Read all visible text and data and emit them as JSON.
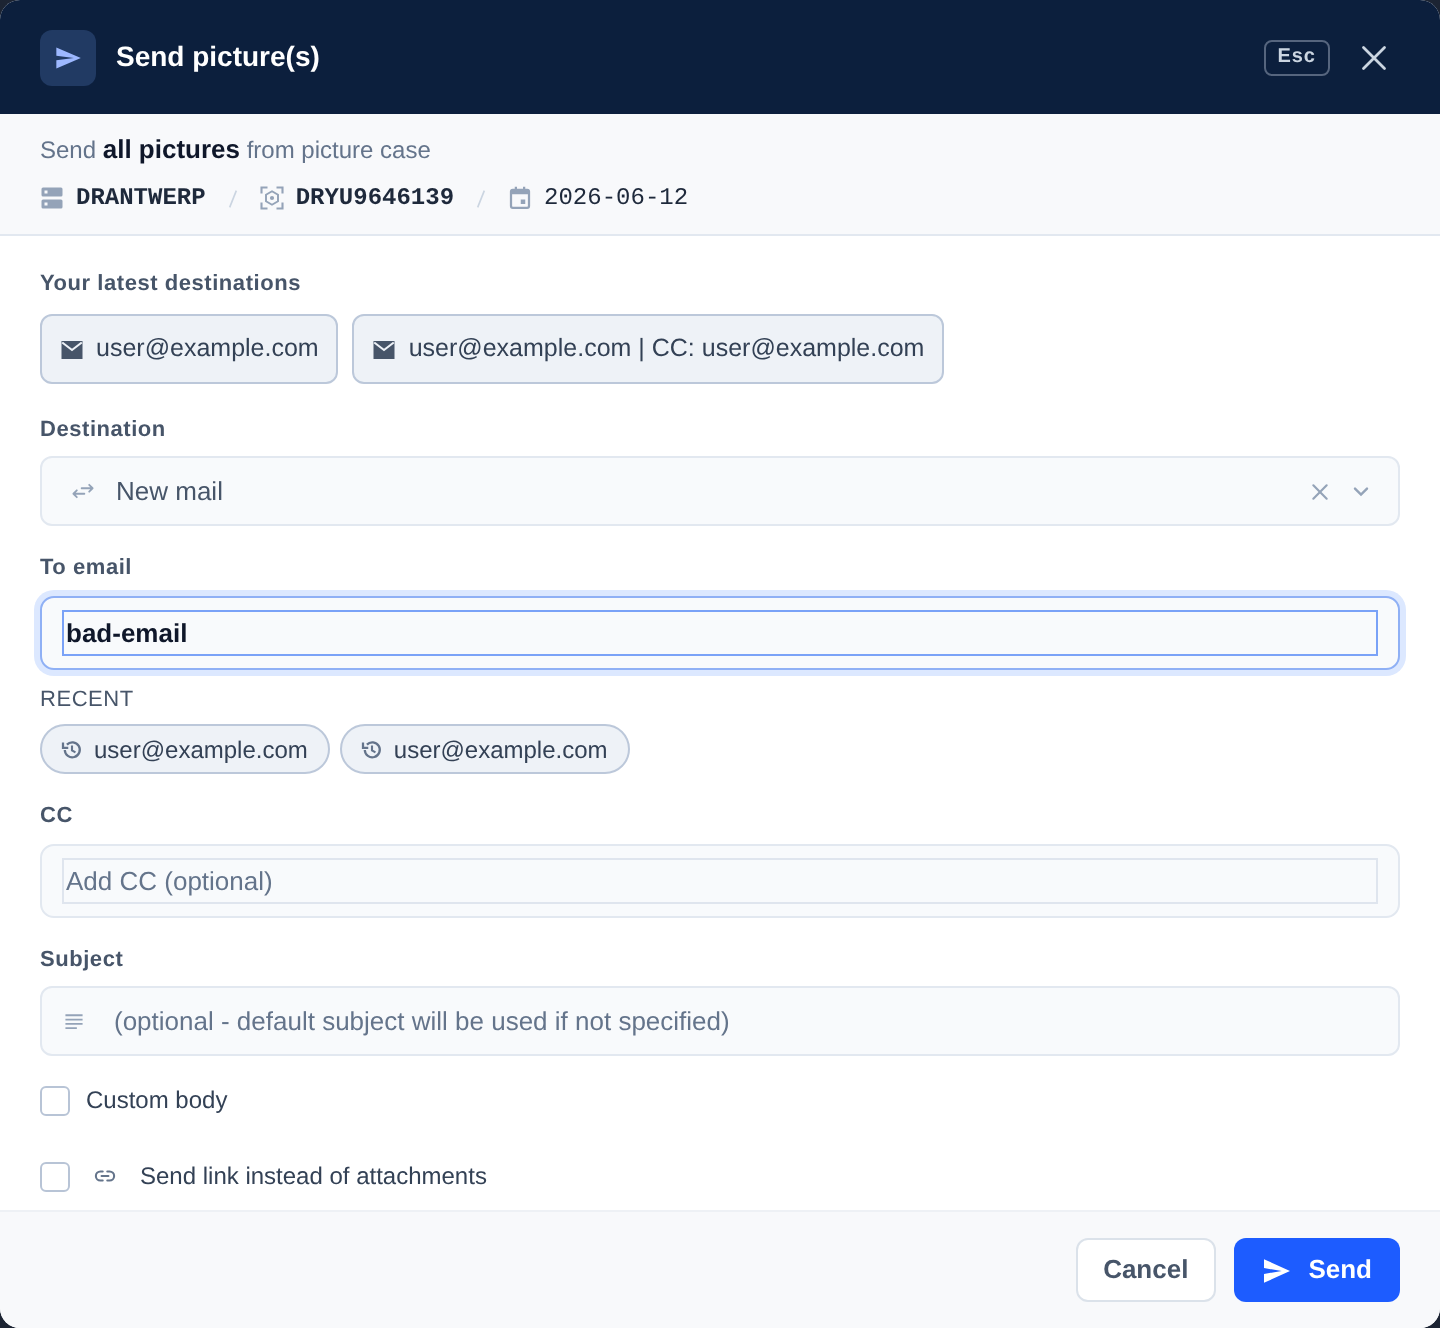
{
  "dialog": {
    "title": "Send picture(s)",
    "shortcut": "Esc"
  },
  "summary": {
    "text": "Send **all pictures** from picture case",
    "meta": [
      {
        "kind": "location",
        "text": "DRANTWERP"
      },
      {
        "kind": "container",
        "text": "DRYU9646139"
      },
      {
        "kind": "date",
        "text": "2026-06-12"
      }
    ]
  },
  "latest_destinations": {
    "label": "Your latest destinations",
    "items": [
      "user@example.com",
      "user@example.com | CC: user@example.com"
    ]
  },
  "destination": {
    "label": "Destination",
    "value": "New mail"
  },
  "to_email": {
    "label": "To email",
    "value": "bad-email",
    "focused": true
  },
  "recent": {
    "label": "RECENT",
    "items": [
      "user@example.com",
      "user@example.com"
    ]
  },
  "cc": {
    "label": "CC",
    "placeholder": "Add CC (optional)"
  },
  "subject": {
    "label": "Subject",
    "placeholder": "(optional - default subject will be used if not specified)"
  },
  "options": [
    {
      "kind": "plain",
      "label": "Custom body",
      "checked": false
    },
    {
      "kind": "link",
      "label": "Send link instead of attachments",
      "checked": false
    }
  ],
  "buttons": [
    {
      "kind": "secondary",
      "label": "Cancel"
    },
    {
      "kind": "primary",
      "label": "Send"
    }
  ]
}
